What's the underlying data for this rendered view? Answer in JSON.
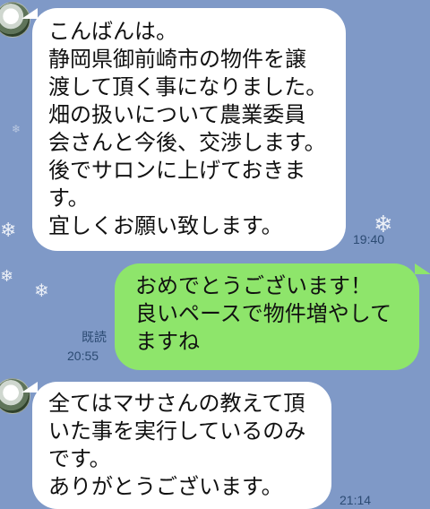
{
  "messages": {
    "m1": {
      "lines": [
        "こんばんは。",
        "静岡県御前崎市の物件を譲",
        "渡して頂く事になりました。",
        "畑の扱いについて農業委員",
        "会さんと今後、交渉します。",
        "後でサロンに上げておきま",
        "す。",
        "宜しくお願い致します。"
      ],
      "time": "19:40"
    },
    "m2": {
      "lines": [
        "おめでとうございます！",
        "良いペースで物件増やして",
        "ますね"
      ],
      "read": "既読",
      "time": "20:55"
    },
    "m3": {
      "lines": [
        "全てはマサさんの教えて頂",
        "いた事を実行しているのみ",
        "です。",
        "ありがとうございます。"
      ],
      "time": "21:14"
    }
  },
  "icons": {
    "avatar": "avatar",
    "snowflake": "snowflake-icon"
  },
  "colors": {
    "background": "#7f99c7",
    "incoming_bubble": "#ffffff",
    "outgoing_bubble": "#8ee56b",
    "meta_text": "#2c4b73"
  }
}
